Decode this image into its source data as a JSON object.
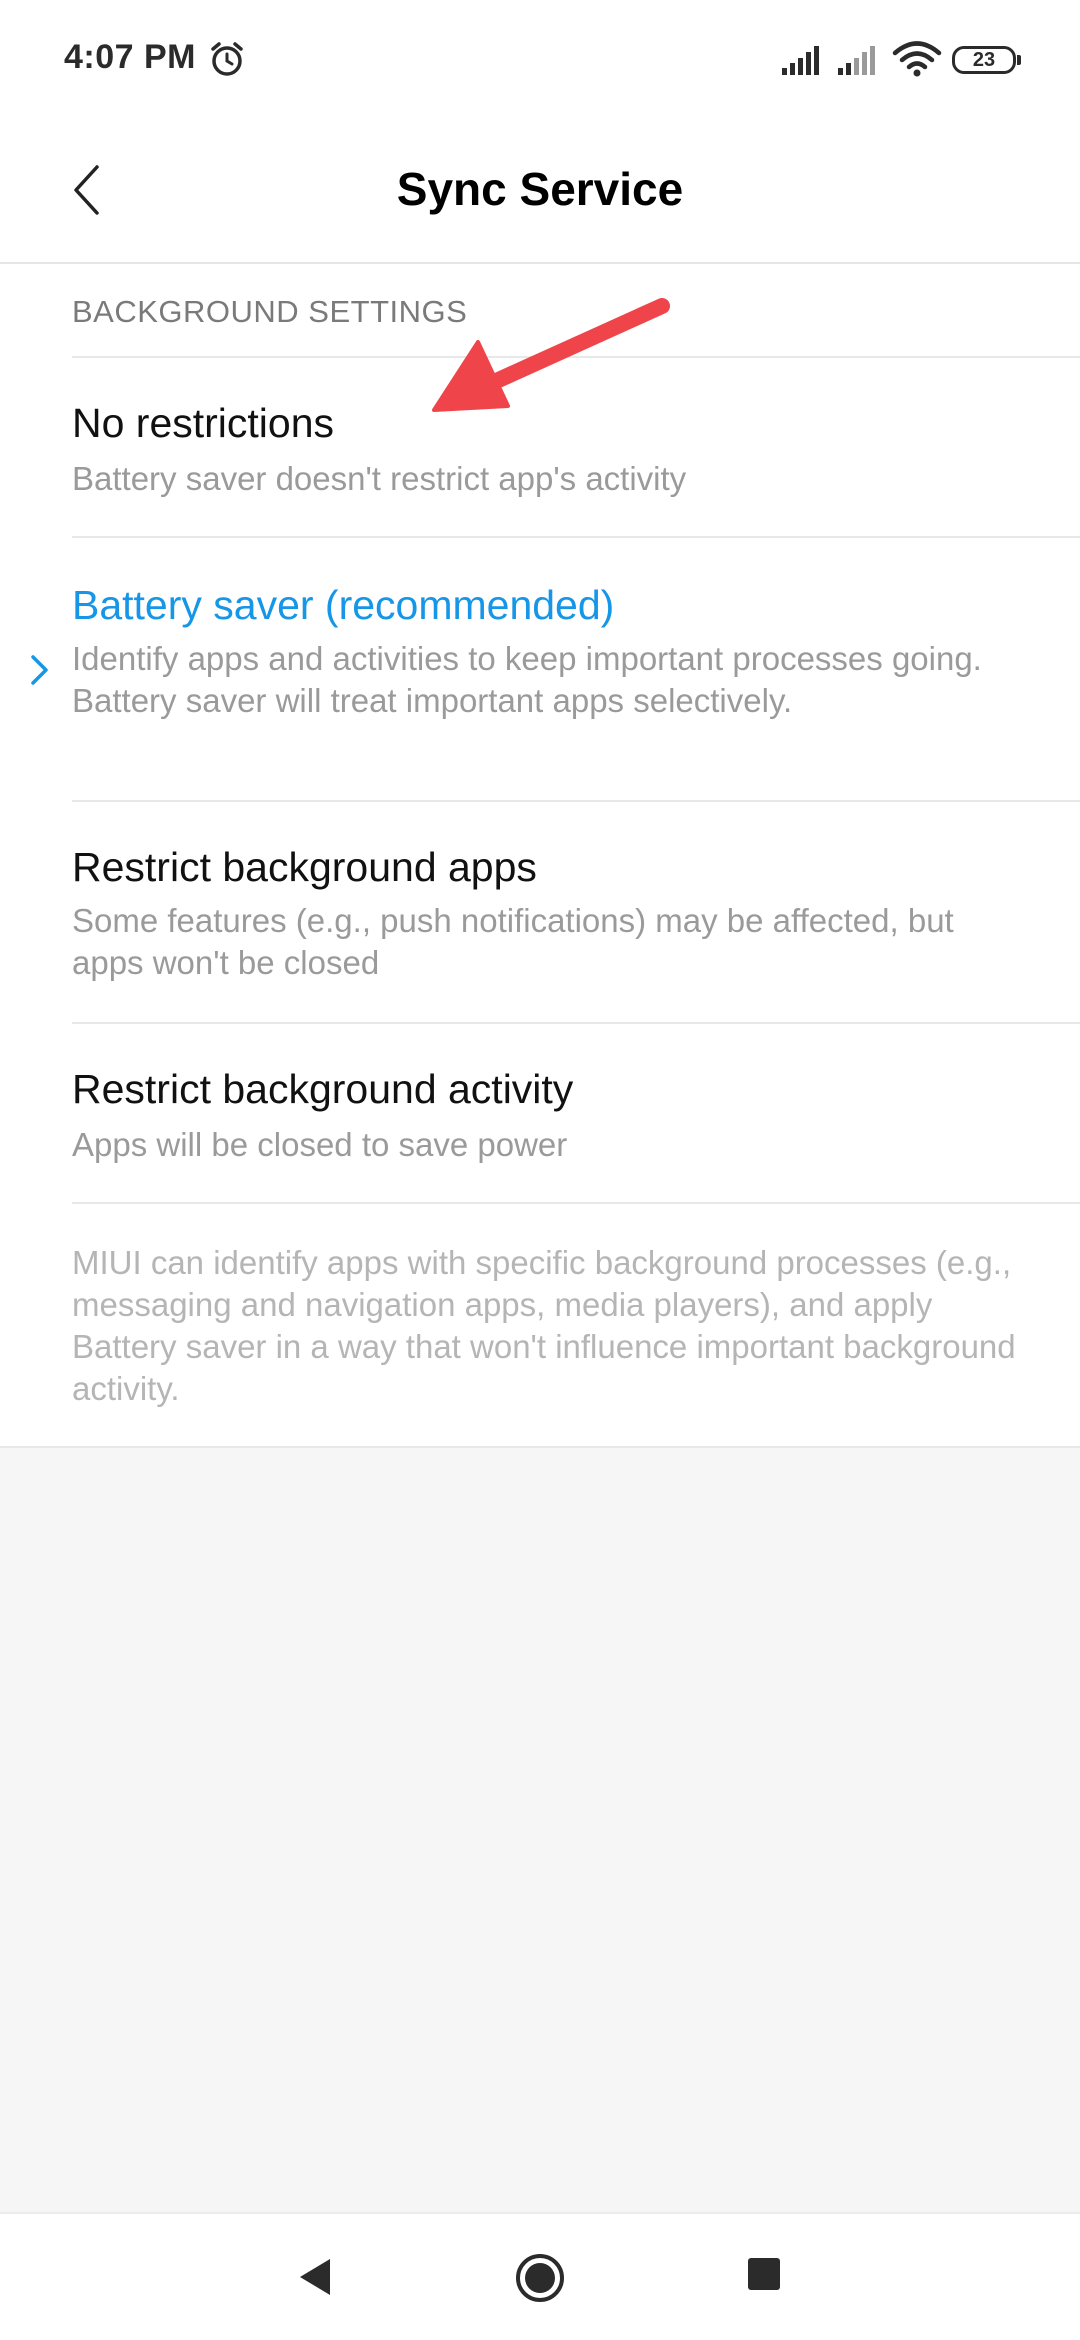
{
  "status_bar": {
    "time": "4:07 PM",
    "battery_level": "23",
    "icons": [
      "alarm-icon",
      "signal-icon",
      "signal-icon",
      "wifi-icon",
      "battery-icon"
    ]
  },
  "header": {
    "title": "Sync Service",
    "back_icon": "back-chevron-icon"
  },
  "section": {
    "header": "BACKGROUND SETTINGS"
  },
  "options": [
    {
      "title": "No restrictions",
      "description": "Battery saver doesn't restrict app's activity",
      "selected": false
    },
    {
      "title": "Battery saver (recommended)",
      "description": "Identify apps and activities to keep important processes going.\nBattery saver will treat important apps selectively.",
      "selected": true
    },
    {
      "title": "Restrict background apps",
      "description": "Some features (e.g., push notifications) may be affected, but apps won't be closed",
      "selected": false
    },
    {
      "title": "Restrict background activity",
      "description": "Apps will be closed to save power",
      "selected": false
    }
  ],
  "footer_note": "MIUI can identify apps with specific background processes (e.g., messaging and navigation apps, media players), and apply Battery saver in a way that won't influence important background activity.",
  "colors": {
    "accent": "#1696e6",
    "annotation_arrow": "#f0444b",
    "primary_text": "#111111",
    "secondary_text": "#9a9a9a"
  },
  "nav_bar": {
    "icons": [
      "nav-back-icon",
      "nav-home-icon",
      "nav-recents-icon"
    ]
  }
}
